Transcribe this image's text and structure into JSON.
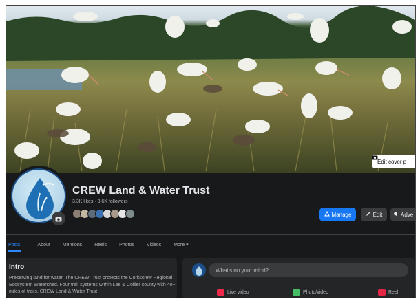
{
  "cover": {
    "edit_cover_label": "Edit cover p",
    "icon": "camera-icon"
  },
  "page": {
    "name": "CREW Land & Water Trust",
    "stats": "3.3K likes · 3.6K followers"
  },
  "actions": {
    "manage_label": "Manage",
    "edit_label": "Edit",
    "advertise_label": "Adve"
  },
  "tabs": [
    {
      "label": "Posts"
    },
    {
      "label": "About"
    },
    {
      "label": "Mentions"
    },
    {
      "label": "Reels"
    },
    {
      "label": "Photos"
    },
    {
      "label": "Videos"
    },
    {
      "label": "More ▾"
    }
  ],
  "intro": {
    "title": "Intro",
    "text": "Preserving land for water. The CREW Trust protects the Corkscrew Regional Ecosystem Watershed. Four trail systems within Lee & Collier county with 40+ miles of trails. CREW Land & Water Trust"
  },
  "composer": {
    "placeholder": "What's on your mind?",
    "live_label": "Live video",
    "photo_label": "Photo/video",
    "reel_label": "Reel"
  },
  "colors": {
    "accent": "#1877f2",
    "background": "#18191a",
    "card": "#242526",
    "live": "#f02849",
    "photo": "#45bd62",
    "reel": "#e42645"
  }
}
